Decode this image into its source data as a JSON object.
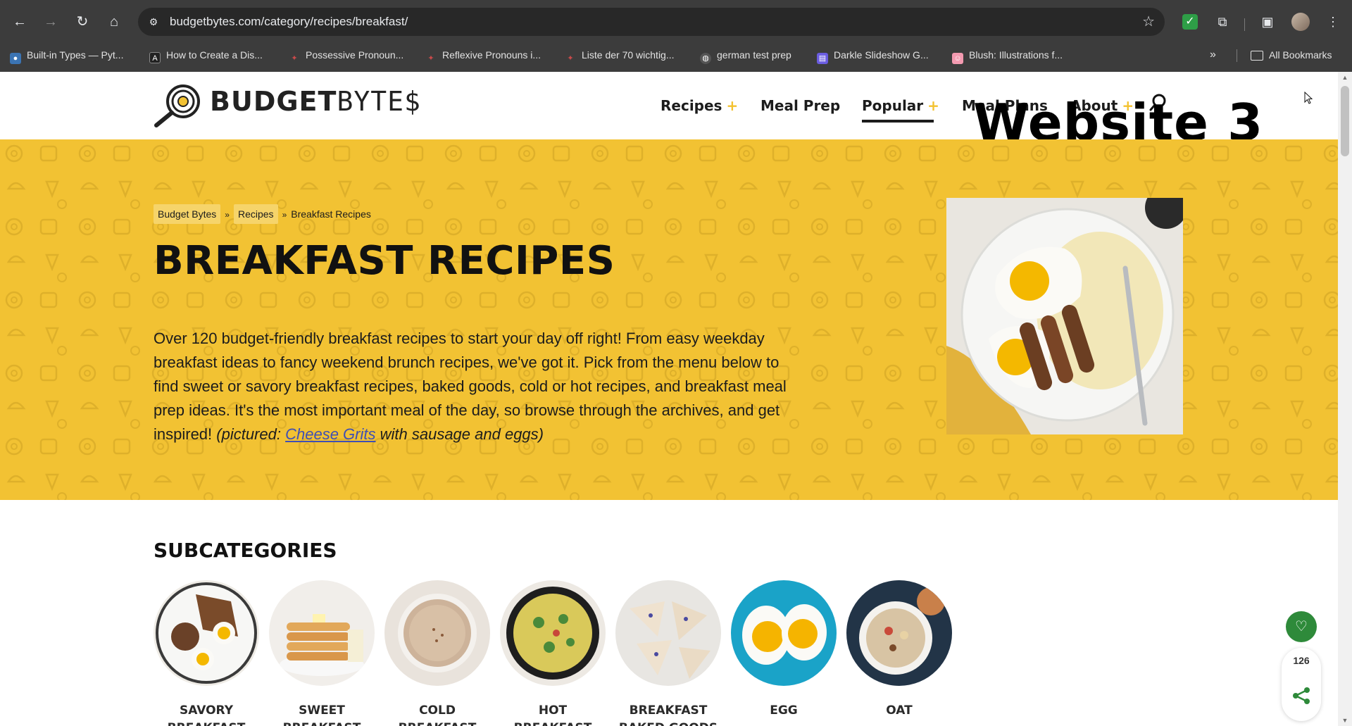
{
  "browser": {
    "url": "budgetbytes.com/category/recipes/breakfast/",
    "bookmarks": [
      {
        "label": "Built-in Types — Pyt...",
        "icon": "python-icon",
        "color": "#3b74b3"
      },
      {
        "label": "How to Create a Dis...",
        "icon": "dev-icon",
        "color": "#222222"
      },
      {
        "label": "Possessive Pronoun...",
        "icon": "fluentu-icon",
        "color": "#c94a4a"
      },
      {
        "label": "Reflexive Pronouns i...",
        "icon": "fluentu-icon",
        "color": "#c94a4a"
      },
      {
        "label": "Liste der 70 wichtig...",
        "icon": "fluentu-icon",
        "color": "#c94a4a"
      },
      {
        "label": "german test prep",
        "icon": "globe-icon",
        "color": "#8a8a8a"
      },
      {
        "label": "Darkle Slideshow G...",
        "icon": "darkle-icon",
        "color": "#6a5ce0"
      },
      {
        "label": "Blush: Illustrations f...",
        "icon": "blush-icon",
        "color": "#f39ab0"
      }
    ],
    "all_bookmarks_label": "All Bookmarks"
  },
  "site": {
    "logo_part1": "BUDGET",
    "logo_part2": "BYTE$",
    "nav": [
      {
        "label": "Recipes",
        "has_plus": true
      },
      {
        "label": "Meal Prep",
        "has_plus": false
      },
      {
        "label": "Popular",
        "has_plus": true,
        "active": true
      },
      {
        "label": "Meal Plans",
        "has_plus": false
      },
      {
        "label": "About",
        "has_plus": true
      }
    ],
    "nav_plus": "+",
    "overlay_caption": "Website 3"
  },
  "hero": {
    "breadcrumb": [
      "Budget Bytes",
      "Recipes",
      "Breakfast Recipes"
    ],
    "breadcrumb_sep": "»",
    "title": "BREAKFAST RECIPES",
    "description": "Over 120 budget-friendly breakfast recipes to start your day off right! From easy weekday breakfast ideas to fancy weekend brunch recipes, we've got it. Pick from the menu below to find sweet or savory breakfast recipes, baked goods, cold or hot recipes, and breakfast meal prep ideas. It's the most important meal of the day, so browse through the archives, and get inspired!",
    "pictured_prefix": "(pictured: ",
    "pictured_link": "Cheese Grits",
    "pictured_suffix": " with sausage and eggs)"
  },
  "subcategories": {
    "title": "SUBCATEGORIES",
    "items": [
      {
        "label": "SAVORY BREAKFAST"
      },
      {
        "label": "SWEET BREAKFAST"
      },
      {
        "label": "COLD BREAKFAST"
      },
      {
        "label": "HOT BREAKFAST"
      },
      {
        "label": "BREAKFAST BAKED GOODS"
      },
      {
        "label": "EGG"
      },
      {
        "label": "OAT"
      }
    ]
  },
  "floating": {
    "share_count": "126"
  },
  "colors": {
    "hero_yellow": "#f2c233",
    "accent_plus": "#f3c22f",
    "heart_green": "#2e8a3a",
    "link_blue": "#3f4fb4"
  }
}
